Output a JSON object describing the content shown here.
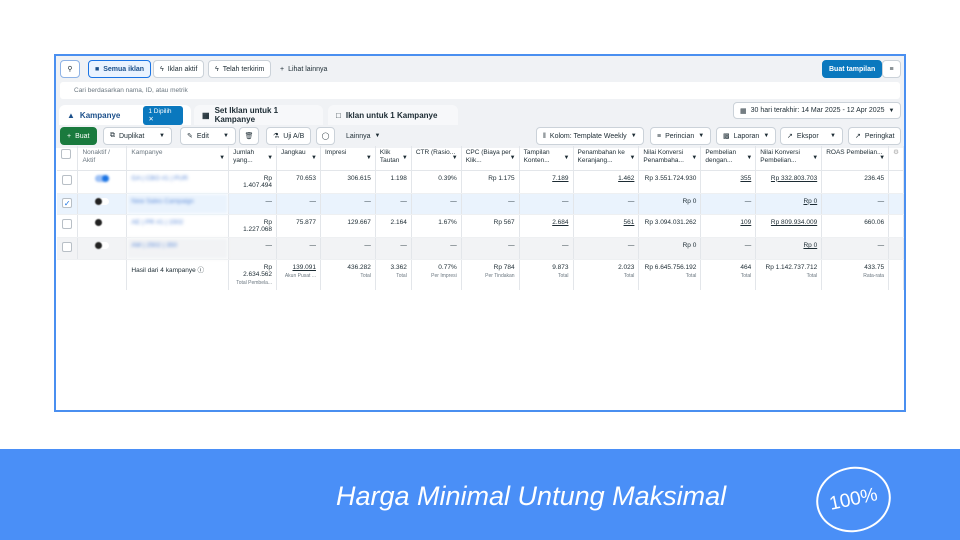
{
  "toolbar": {
    "views": [
      "Semua iklan",
      "Iklan aktif",
      "Telah terkirim"
    ],
    "more": "Lihat lainnya",
    "create_view": "Buat tampilan"
  },
  "search": {
    "placeholder": "Cari berdasarkan nama, ID, atau metrik"
  },
  "tabs": {
    "campaigns": "Kampanye",
    "selected_chip": "1 Dipilih",
    "adsets": "Set Iklan untuk 1 Kampanye",
    "ads": "Iklan untuk 1 Kampanye"
  },
  "date_range": "30 hari terakhir: 14 Mar 2025 - 12 Apr 2025",
  "actions": {
    "create": "Buat",
    "duplicate": "Duplikat",
    "edit": "Edit",
    "ab_test": "Uji A/B",
    "more": "Lainnya",
    "columns": "Kolom: Template Weekly",
    "breakdown": "Perincian",
    "reports": "Laporan",
    "export": "Ekspor",
    "ranking": "Peringkat"
  },
  "columns": [
    "Nonaktif / Aktif",
    "Kampanye",
    "Jumlah yang...",
    "Jangkau",
    "Impresi",
    "Klik Tautan",
    "CTR (Rasio...",
    "CPC (Biaya per Klik...",
    "Tampilan Konten...",
    "Penambahan ke Keranjang...",
    "Nilai Konversi Penambaha...",
    "Pembelian dengan...",
    "Nilai Konversi Pembelian...",
    "ROAS Pembelian..."
  ],
  "rows": [
    {
      "name": "GA | CBO #1 | PUR",
      "active": true,
      "selected": false,
      "values": [
        "Rp 1.407.494",
        "70.653",
        "306.615",
        "1.198",
        "0.39%",
        "Rp 1.175",
        "7.189",
        "1.462",
        "Rp 3.551.724.930",
        "355",
        "Rp 332.803.703",
        "236.45"
      ]
    },
    {
      "name": "New Sales Campaign",
      "active": false,
      "selected": true,
      "values": [
        "—",
        "—",
        "—",
        "—",
        "—",
        "—",
        "—",
        "—",
        "Rp 0",
        "—",
        "Rp 0",
        "—"
      ]
    },
    {
      "name": "AE | PR #1 | 1502",
      "active": false,
      "selected": false,
      "values": [
        "Rp 1.227.068",
        "75.877",
        "129.667",
        "2.164",
        "1.67%",
        "Rp 567",
        "2.684",
        "561",
        "Rp 3.094.031.262",
        "109",
        "Rp 809.934.009",
        "660.06"
      ]
    },
    {
      "name": "AM | 2502 | 350",
      "active": false,
      "selected": false,
      "values": [
        "—",
        "—",
        "—",
        "—",
        "—",
        "—",
        "—",
        "—",
        "Rp 0",
        "—",
        "Rp 0",
        "—"
      ]
    }
  ],
  "summary": {
    "label": "Hasil dari 4 kampanye",
    "values": [
      "Rp 2.634.562",
      "139.091",
      "436.282",
      "3.362",
      "0.77%",
      "Rp 784",
      "9.873",
      "2.023",
      "Rp 6.645.756.192",
      "464",
      "Rp 1.142.737.712",
      "433.75"
    ],
    "subs": [
      "Total Pembela...",
      "Akun Pusat ...",
      "Total",
      "Total",
      "Per Impresi",
      "Per Tindakan",
      "Total",
      "Total",
      "Total",
      "Total",
      "Total",
      "Rata-rata"
    ]
  },
  "banner": {
    "slogan": "Harga Minimal Untung Maksimal",
    "badge": "100%"
  }
}
